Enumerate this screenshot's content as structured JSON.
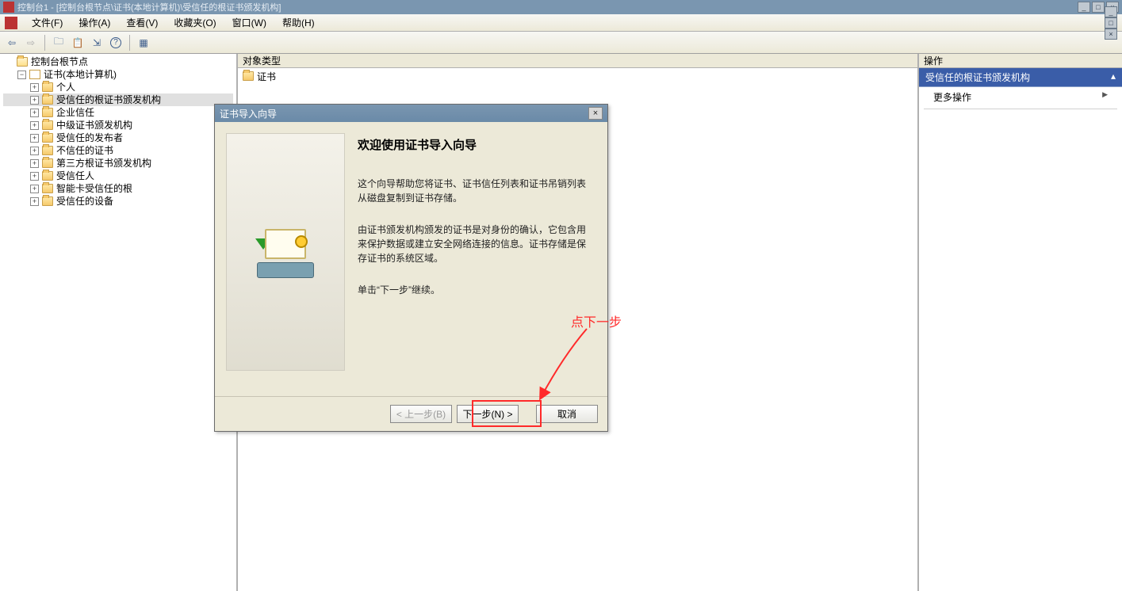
{
  "window": {
    "title": "控制台1 - [控制台根节点\\证书(本地计算机)\\受信任的根证书颁发机构]",
    "minimize": "_",
    "maximize": "□",
    "close": "×"
  },
  "menu": {
    "file": "文件(F)",
    "action": "操作(A)",
    "view": "查看(V)",
    "favorites": "收藏夹(O)",
    "window": "窗口(W)",
    "help": "帮助(H)"
  },
  "toolbar_icons": {
    "back": "⬅",
    "forward": "➡",
    "up": "⬆",
    "cut": "✂",
    "props": "☰",
    "refresh": "⟳",
    "export": "⇲",
    "help": "?"
  },
  "tree": {
    "root": "控制台根节点",
    "certs": "证书(本地计算机)",
    "items": [
      "个人",
      "受信任的根证书颁发机构",
      "企业信任",
      "中级证书颁发机构",
      "受信任的发布者",
      "不信任的证书",
      "第三方根证书颁发机构",
      "受信任人",
      "智能卡受信任的根",
      "受信任的设备"
    ]
  },
  "list": {
    "header": "对象类型",
    "item0": "证书"
  },
  "actions": {
    "header": "操作",
    "group": "受信任的根证书颁发机构",
    "more": "更多操作"
  },
  "dialog": {
    "title": "证书导入向导",
    "heading": "欢迎使用证书导入向导",
    "para1": "这个向导帮助您将证书、证书信任列表和证书吊销列表从磁盘复制到证书存储。",
    "para2": "由证书颁发机构颁发的证书是对身份的确认，它包含用来保护数据或建立安全网络连接的信息。证书存储是保存证书的系统区域。",
    "para3": "单击“下一步”继续。",
    "back": "< 上一步(B)",
    "next": "下一步(N) >",
    "cancel": "取消",
    "close": "×"
  },
  "annotation": "点下一步"
}
